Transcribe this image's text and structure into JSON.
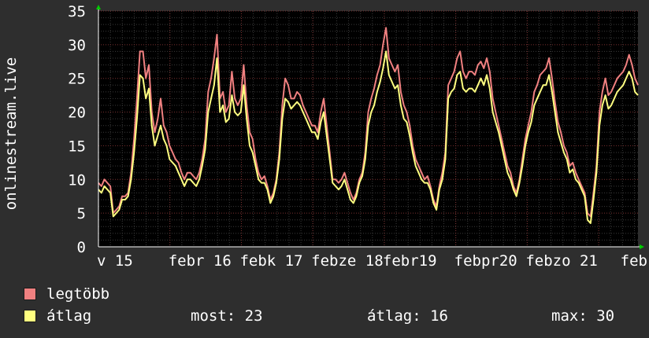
{
  "chart_data": {
    "type": "line",
    "ylabel": "onlinestream.live",
    "ylim": [
      0,
      35
    ],
    "yticks": [
      0,
      5,
      10,
      15,
      20,
      25,
      30,
      35
    ],
    "grid": true,
    "xlim": [
      0,
      7.55
    ],
    "xticks": [
      {
        "label": "v 15",
        "x": 0
      },
      {
        "label": "febr 16",
        "x": 1
      },
      {
        "label": "febk 17",
        "x": 2
      },
      {
        "label": "febze 18",
        "x": 3
      },
      {
        "label": "febr19",
        "x": 4
      },
      {
        "label": "febpr20",
        "x": 5
      },
      {
        "label": "febzo 21",
        "x": 6
      },
      {
        "label": "feb",
        "x": 7
      }
    ],
    "series": [
      {
        "name": "legtöbb",
        "color": "#f08080",
        "values": [
          9.5,
          9,
          10,
          9.5,
          9,
          5,
          5.5,
          6,
          7.5,
          7.5,
          8,
          11,
          16,
          22,
          29,
          29,
          25,
          27,
          20,
          17,
          19,
          22,
          18,
          17,
          15,
          14,
          13,
          12.5,
          11,
          10,
          11,
          11,
          10.5,
          10,
          11,
          13,
          16,
          23,
          25,
          28,
          31.5,
          22,
          23,
          20,
          21,
          26,
          22,
          21,
          22,
          27,
          21,
          17,
          16,
          13,
          11,
          10,
          10.5,
          9,
          7,
          8,
          10,
          14,
          21,
          25,
          24,
          22,
          22,
          23,
          22.5,
          21,
          20,
          19,
          18,
          18,
          17,
          20,
          22,
          18,
          14,
          10,
          10,
          9.5,
          10,
          11,
          9.5,
          8,
          7,
          8,
          10,
          11,
          14,
          20,
          22,
          23.5,
          25.5,
          27,
          30,
          32.5,
          28,
          27,
          26,
          27,
          23,
          21,
          20,
          18,
          15,
          13,
          12,
          11,
          10,
          10.5,
          9,
          7,
          6,
          9,
          11,
          14,
          24,
          25,
          26,
          28,
          29,
          26,
          25,
          26,
          26,
          25.5,
          27,
          27.5,
          26.5,
          28,
          26,
          22,
          20,
          18,
          16,
          14,
          12,
          11,
          9,
          8,
          10,
          13,
          16,
          18,
          20,
          23,
          24,
          25.5,
          26,
          26.5,
          28,
          25,
          21.5,
          18.5,
          17,
          15,
          14,
          12,
          12.5,
          11,
          10,
          9,
          8,
          5,
          4.5,
          8,
          12,
          20,
          23,
          25,
          22.5,
          23,
          24,
          25,
          25.5,
          26,
          27,
          28.5,
          27,
          25,
          24
        ],
        "legend_label": "legtöbb"
      },
      {
        "name": "átlag",
        "color": "#ffff80",
        "values": [
          8.5,
          8,
          9,
          8.5,
          8,
          4.5,
          5,
          5.5,
          7,
          7,
          7.5,
          10,
          14,
          19,
          25.5,
          25,
          22,
          23.5,
          18,
          15,
          16.5,
          18,
          16,
          15,
          13,
          12.5,
          12,
          11,
          10,
          9,
          10,
          10,
          9.5,
          9,
          10,
          12,
          14.5,
          20,
          22,
          24,
          28,
          20,
          21,
          18.5,
          19,
          22.5,
          20,
          19.5,
          20,
          24,
          19,
          15,
          14,
          12,
          10,
          9.5,
          9.5,
          8.5,
          6.5,
          7.5,
          9.5,
          13,
          19,
          22,
          21.5,
          20.5,
          21,
          21.5,
          21,
          20,
          19,
          18,
          17,
          17,
          16,
          18.5,
          20,
          16.5,
          13,
          9.5,
          9,
          8.5,
          9,
          10,
          8.5,
          7,
          6.5,
          7.5,
          9.5,
          10.5,
          13,
          18,
          20,
          21,
          23,
          24.5,
          26.5,
          29,
          25.5,
          24.5,
          23.5,
          24,
          21,
          19,
          18.5,
          16.5,
          14,
          12,
          11,
          10,
          9.5,
          9.5,
          8.5,
          6.5,
          5.5,
          8.5,
          10,
          13,
          22,
          23,
          23.5,
          25.5,
          26,
          23.5,
          23,
          23.5,
          23.5,
          23,
          24,
          25,
          24,
          25.5,
          23.5,
          20,
          18.5,
          17,
          15,
          13,
          11,
          10,
          8.5,
          7.5,
          9.5,
          12,
          15,
          17,
          18.5,
          21,
          22,
          23,
          24,
          24,
          25.5,
          23,
          20,
          17,
          15.5,
          14,
          13,
          11,
          11.5,
          10,
          9.5,
          8.5,
          7.5,
          4,
          3.5,
          7,
          11,
          18,
          21,
          22.5,
          20.5,
          21,
          22,
          23,
          23.5,
          24,
          25,
          26,
          25,
          23,
          22.5
        ],
        "legend_label": "átlag"
      }
    ]
  },
  "legend": {
    "stat_most": "most: 23",
    "stat_atlag": "átlag: 16",
    "stat_max": "max: 30"
  },
  "colors": {
    "background": "#2e2e2e",
    "plot_background": "#000000",
    "grid_major": "#7a3030",
    "grid_minor": "#3a3a3a",
    "axis": "#ffffff",
    "arrow": "#00cc00"
  }
}
